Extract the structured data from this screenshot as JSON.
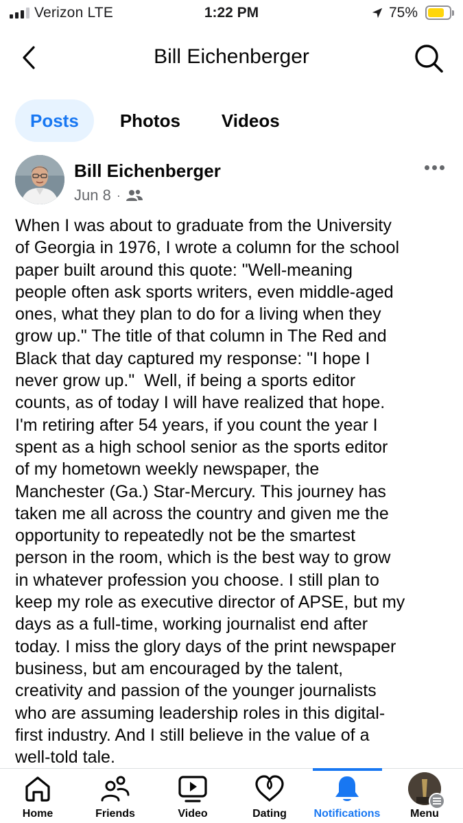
{
  "status_bar": {
    "carrier": "Verizon  LTE",
    "time": "1:22 PM",
    "battery_percent": "75%",
    "battery_level": 0.75,
    "signal_bars": 3
  },
  "header": {
    "title": "Bill Eichenberger",
    "back_icon": "chevron-left-icon",
    "search_icon": "search-icon"
  },
  "tabs": [
    {
      "label": "Posts",
      "active": true
    },
    {
      "label": "Photos",
      "active": false
    },
    {
      "label": "Videos",
      "active": false
    }
  ],
  "post": {
    "author": "Bill Eichenberger",
    "date": "Jun 8",
    "separator": "·",
    "audience_icon": "friends-audience-icon",
    "more_icon": "more-options-icon",
    "lines": [
      "When I was about to graduate from the University",
      "of Georgia in 1976, I wrote a column for the school",
      "paper built around this quote: \"Well-meaning",
      "people often ask sports writers, even middle-aged",
      "ones, what they plan to do for a living when they",
      "grow up.\" The title of that column in The Red and",
      "Black that day captured my response: \"I hope I",
      "never grow up.\"  Well, if being a sports editor",
      "counts, as of today I will have realized that hope.",
      "I'm retiring after 54 years, if you count the year I",
      "spent as a high school senior as the sports editor",
      "of my hometown weekly newspaper, the",
      "Manchester (Ga.) Star-Mercury. This journey has",
      "taken me all across the country and given me the",
      "opportunity to repeatedly not be the smartest",
      "person in the room, which is the best way to grow",
      "in whatever profession you choose. I still plan to",
      "keep my role as executive director of APSE, but my",
      "days as a full-time, working journalist end after",
      "today. I miss the glory days of the print newspaper",
      "business, but am encouraged by the talent,",
      "creativity and passion of the younger journalists",
      "who are assuming leadership roles in this digital-",
      "first industry. And I still believe in the value of a",
      "well-told tale."
    ]
  },
  "bottom_nav": [
    {
      "label": "Home",
      "icon": "home-icon",
      "active": false
    },
    {
      "label": "Friends",
      "icon": "friends-icon",
      "active": false
    },
    {
      "label": "Video",
      "icon": "video-icon",
      "active": false
    },
    {
      "label": "Dating",
      "icon": "dating-heart-icon",
      "active": false
    },
    {
      "label": "Notifications",
      "icon": "bell-icon",
      "active": true
    },
    {
      "label": "Menu",
      "icon": "profile-menu-icon",
      "active": false
    }
  ],
  "colors": {
    "accent": "#1877f2",
    "active_tab_bg": "#e7f3ff",
    "secondary_text": "#65676b",
    "battery_fill": "#ffd60a"
  }
}
